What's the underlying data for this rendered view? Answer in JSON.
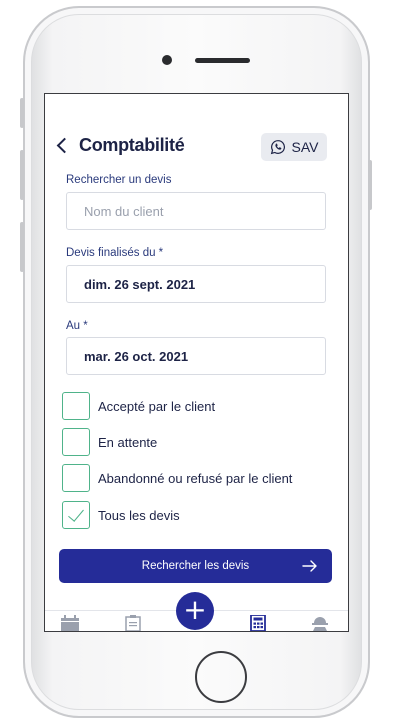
{
  "header": {
    "title": "Comptabilité",
    "sav_label": "SAV"
  },
  "search": {
    "label": "Rechercher un devis",
    "placeholder": "Nom du client"
  },
  "date_from": {
    "label": "Devis finalisés du *",
    "value": "dim. 26 sept. 2021"
  },
  "date_to": {
    "label": "Au *",
    "value": "mar. 26 oct. 2021"
  },
  "filters": [
    {
      "label": "Accepté par le client",
      "checked": false
    },
    {
      "label": "En attente",
      "checked": false
    },
    {
      "label": "Abandonné ou refusé par le client",
      "checked": false
    },
    {
      "label": "Tous les devis",
      "checked": true
    }
  ],
  "search_button": {
    "label": "Rechercher les devis"
  },
  "tabbar": {
    "icons": [
      "calendar-icon",
      "clipboard-icon",
      "add-icon",
      "calculator-icon",
      "worker-icon"
    ],
    "active": "calculator-icon"
  },
  "colors": {
    "primary": "#252c98",
    "text": "#1d2346",
    "accent_green": "#4fb38a"
  }
}
